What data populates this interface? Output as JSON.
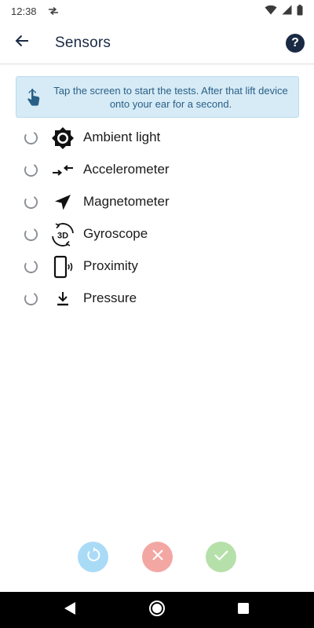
{
  "status_bar": {
    "time": "12:38",
    "left_icon": "data-transfer-icon",
    "right_icons": [
      "wifi-icon",
      "signal-icon",
      "battery-icon"
    ]
  },
  "app_bar": {
    "title": "Sensors",
    "back_icon": "arrow-back-icon",
    "help_icon": "help-icon",
    "help_glyph": "?"
  },
  "info_banner": {
    "icon": "tap-hand-icon",
    "text": "Tap the screen to start the tests. After that lift device onto your ear for a second."
  },
  "sensors": [
    {
      "label": "Ambient light",
      "icon": "brightness-icon"
    },
    {
      "label": "Accelerometer",
      "icon": "compress-arrows-icon"
    },
    {
      "label": "Magnetometer",
      "icon": "navigation-arrow-icon"
    },
    {
      "label": "Gyroscope",
      "icon": "rotate-3d-icon",
      "icon_text": "3D"
    },
    {
      "label": "Proximity",
      "icon": "phone-vibrate-icon"
    },
    {
      "label": "Pressure",
      "icon": "download-arrow-icon"
    }
  ],
  "actions": {
    "retry_icon": "refresh-icon",
    "fail_icon": "close-icon",
    "pass_icon": "check-icon"
  },
  "nav_bar": {
    "back_icon": "nav-back-icon",
    "home_icon": "nav-home-icon",
    "recents_icon": "nav-recents-icon"
  },
  "colors": {
    "title": "#1a2a44",
    "banner_bg": "#d6ebf6",
    "banner_text": "#2a5f86",
    "retry": "#a9dbf6",
    "fail": "#f3a7a3",
    "pass": "#b6e0a9"
  }
}
